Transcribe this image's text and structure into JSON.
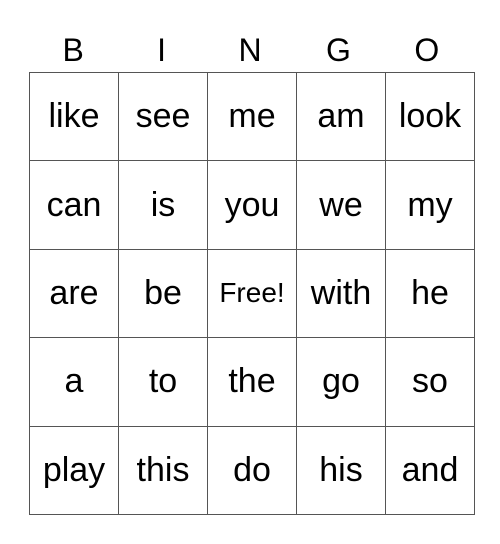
{
  "header": [
    "B",
    "I",
    "N",
    "G",
    "O"
  ],
  "free_label": "Free!",
  "rows": [
    [
      "like",
      "see",
      "me",
      "am",
      "look"
    ],
    [
      "can",
      "is",
      "you",
      "we",
      "my"
    ],
    [
      "are",
      "be",
      "Free!",
      "with",
      "he"
    ],
    [
      "a",
      "to",
      "the",
      "go",
      "so"
    ],
    [
      "play",
      "this",
      "do",
      "his",
      "and"
    ]
  ]
}
